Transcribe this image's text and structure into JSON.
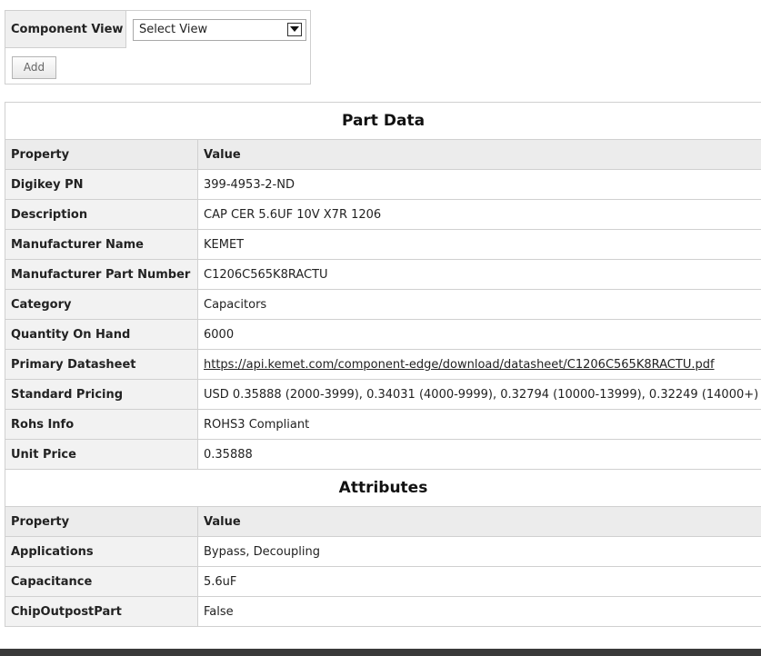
{
  "view_panel": {
    "label": "Component View",
    "select_value": "Select View",
    "add_button": "Add"
  },
  "part_data": {
    "title": "Part Data",
    "col_property": "Property",
    "col_value": "Value",
    "rows": [
      {
        "property": "Digikey PN",
        "value": "399-4953-2-ND"
      },
      {
        "property": "Description",
        "value": "CAP CER 5.6UF 10V X7R 1206"
      },
      {
        "property": "Manufacturer Name",
        "value": "KEMET"
      },
      {
        "property": "Manufacturer Part Number",
        "value": "C1206C565K8RACTU"
      },
      {
        "property": "Category",
        "value": "Capacitors"
      },
      {
        "property": "Quantity On Hand",
        "value": "6000"
      },
      {
        "property": "Primary Datasheet",
        "value": "https://api.kemet.com/component-edge/download/datasheet/C1206C565K8RACTU.pdf"
      },
      {
        "property": "Standard Pricing",
        "value": "USD 0.35888 (2000-3999), 0.34031 (4000-9999), 0.32794 (10000-13999), 0.32249 (14000+)"
      },
      {
        "property": "Rohs Info",
        "value": "ROHS3 Compliant"
      },
      {
        "property": "Unit Price",
        "value": "0.35888"
      }
    ]
  },
  "attributes": {
    "title": "Attributes",
    "col_property": "Property",
    "col_value": "Value",
    "rows": [
      {
        "property": "Applications",
        "value": "Bypass, Decoupling"
      },
      {
        "property": "Capacitance",
        "value": "5.6uF"
      },
      {
        "property": "ChipOutpostPart",
        "value": "False"
      }
    ]
  }
}
